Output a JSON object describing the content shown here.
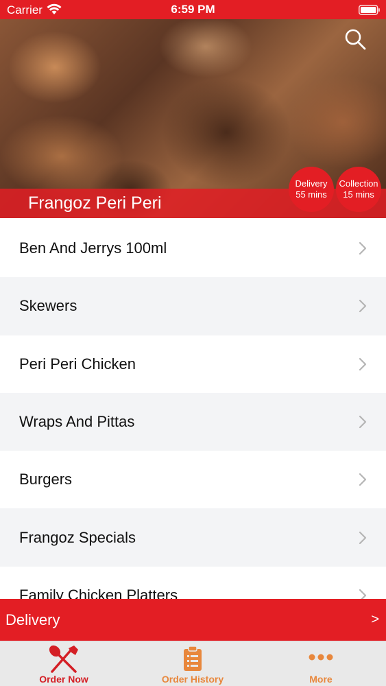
{
  "status_bar": {
    "carrier": "Carrier",
    "time": "6:59 PM"
  },
  "header": {
    "restaurant_name": "Frangoz Peri Peri",
    "delivery": {
      "label": "Delivery",
      "time": "55 mins"
    },
    "collection": {
      "label": "Collection",
      "time": "15 mins"
    },
    "search_icon": "search-icon"
  },
  "menu": {
    "items": [
      {
        "label": "Ben And Jerrys 100ml"
      },
      {
        "label": "Skewers"
      },
      {
        "label": "Peri Peri Chicken"
      },
      {
        "label": "Wraps And Pittas"
      },
      {
        "label": "Burgers"
      },
      {
        "label": "Frangoz Specials"
      },
      {
        "label": "Family Chicken Platters"
      }
    ]
  },
  "order_bar": {
    "label": "Delivery",
    "arrow": ">"
  },
  "tabs": [
    {
      "label": "Order Now",
      "icon": "fork-knife-icon"
    },
    {
      "label": "Order History",
      "icon": "clipboard-icon"
    },
    {
      "label": "More",
      "icon": "more-dots-icon"
    }
  ],
  "colors": {
    "brand_red": "#e31e24",
    "tab_active": "#d41f25",
    "tab_inactive": "#e8873c",
    "row_alt": "#f3f4f6"
  }
}
